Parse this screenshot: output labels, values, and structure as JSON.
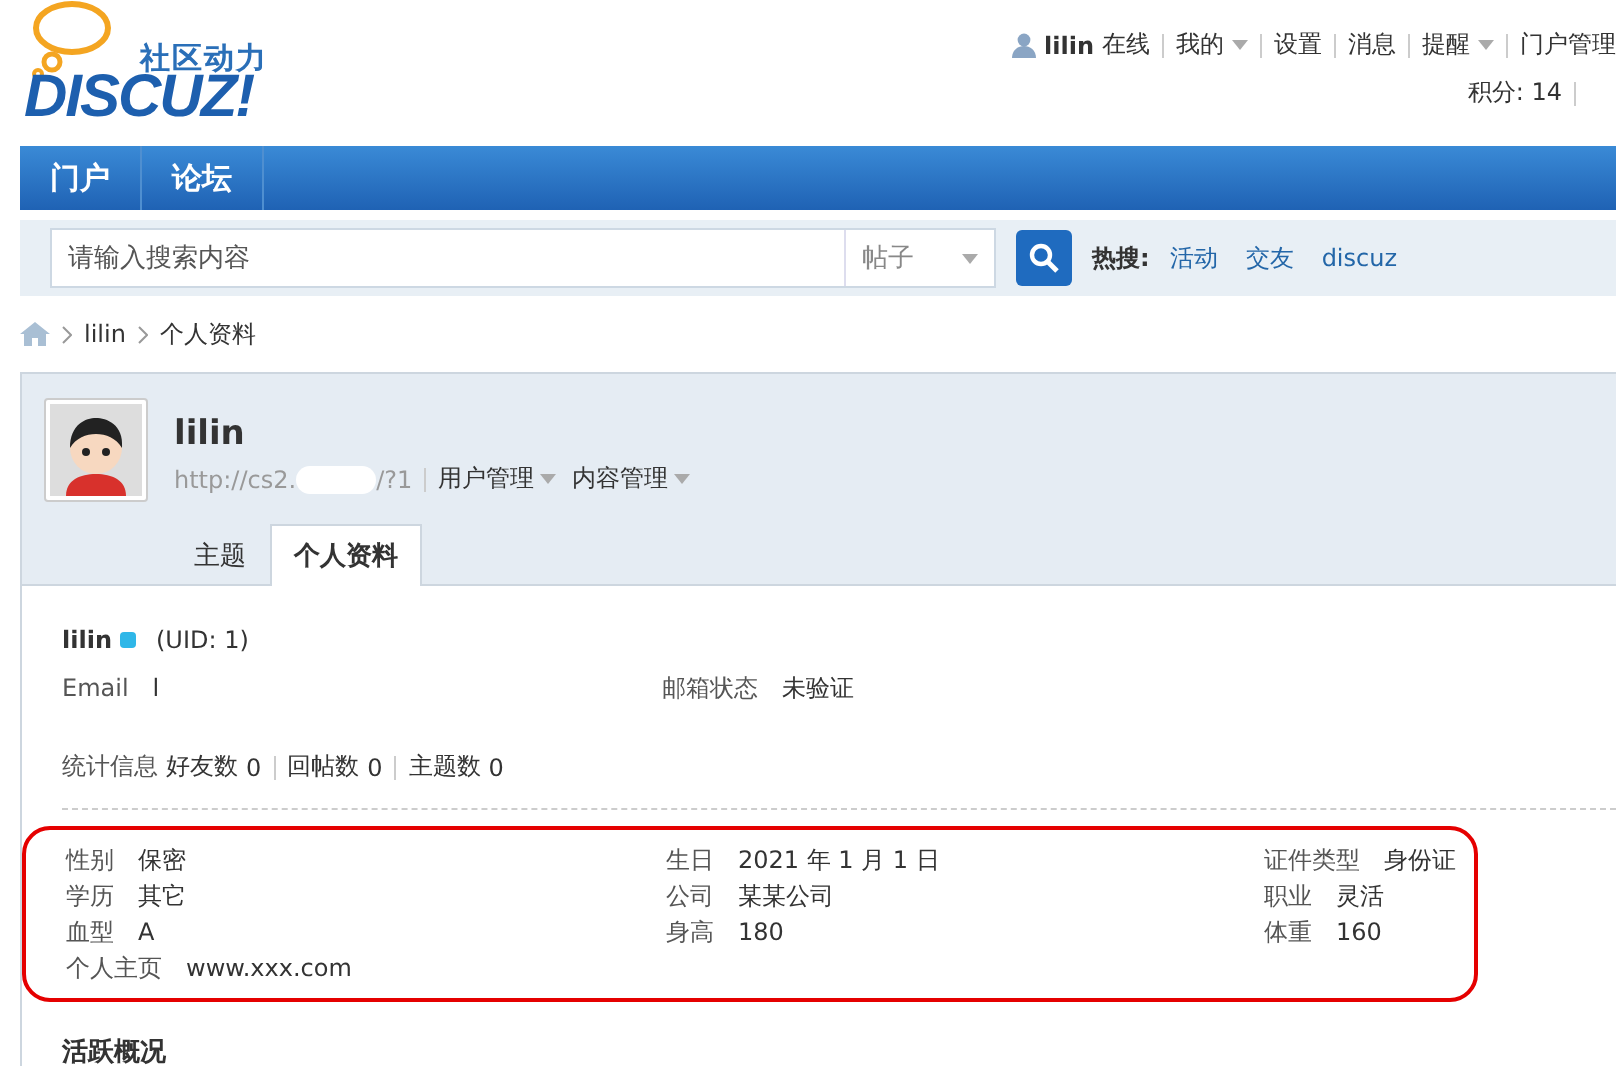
{
  "logo": {
    "tagline": "社区动力",
    "wordmark": "DISCUZ!"
  },
  "header": {
    "user": {
      "name": "lilin",
      "status": "在线"
    },
    "links": [
      {
        "label": "我的",
        "dropdown": true
      },
      {
        "label": "设置",
        "dropdown": false
      },
      {
        "label": "消息",
        "dropdown": false
      },
      {
        "label": "提醒",
        "dropdown": true
      },
      {
        "label": "门户管理",
        "dropdown": false
      }
    ],
    "points": "积分: 14"
  },
  "nav": {
    "items": [
      {
        "label": "门户"
      },
      {
        "label": "论坛"
      }
    ]
  },
  "search": {
    "placeholder": "请输入搜索内容",
    "type": "帖子",
    "hot_label": "热搜:",
    "hot_links": [
      "活动",
      "交友",
      "discuz"
    ]
  },
  "breadcrumb": [
    "lilin",
    "个人资料"
  ],
  "profile": {
    "name": "lilin",
    "url_start": "http://cs2.",
    "url_end": "/?1",
    "menus": [
      {
        "label": "用户管理",
        "dropdown": true
      },
      {
        "label": "内容管理",
        "dropdown": true
      }
    ],
    "tabs": [
      {
        "label": "主题",
        "selected": false
      },
      {
        "label": "个人资料",
        "selected": true
      }
    ]
  },
  "info": {
    "username": "lilin",
    "online": true,
    "uid": "(UID: 1)",
    "fields": [
      {
        "label": "Email",
        "value": "l"
      },
      {
        "label": "邮箱状态",
        "value": "未验证"
      }
    ],
    "stats": {
      "label": "统计信息",
      "items": [
        {
          "label": "好友数",
          "value": "0"
        },
        {
          "label": "回帖数",
          "value": "0"
        },
        {
          "label": "主题数",
          "value": "0"
        }
      ]
    },
    "details": [
      [
        {
          "label": "性别",
          "value": "保密"
        },
        {
          "label": "生日",
          "value": "2021 年 1 月 1 日"
        },
        {
          "label": "证件类型",
          "value": "身份证"
        }
      ],
      [
        {
          "label": "学历",
          "value": "其它"
        },
        {
          "label": "公司",
          "value": "某某公司"
        },
        {
          "label": "职业",
          "value": "灵活"
        }
      ],
      [
        {
          "label": "血型",
          "value": "A"
        },
        {
          "label": "身高",
          "value": "180"
        },
        {
          "label": "体重",
          "value": "160"
        }
      ],
      [
        {
          "label": "个人主页",
          "value": "www.xxx.com"
        }
      ]
    ],
    "highlighted": true,
    "section_title": "活跃概况"
  }
}
